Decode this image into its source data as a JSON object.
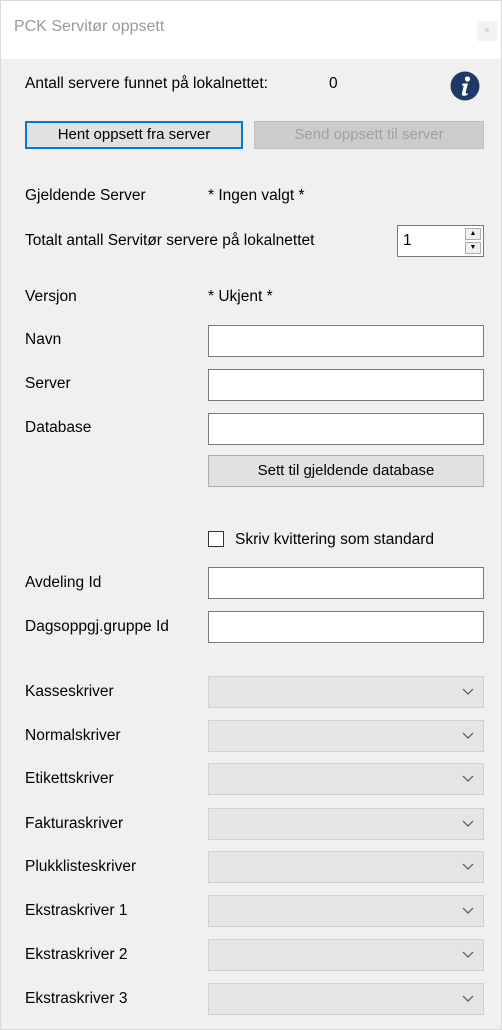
{
  "window": {
    "title": "PCK Servitør oppsett",
    "close_glyph": "×"
  },
  "header": {
    "servers_found_label": "Antall servere funnet på lokalnettet:",
    "servers_found_count": "0",
    "info_icon": "info-icon"
  },
  "buttons": {
    "fetch_label": "Hent oppsett fra server",
    "send_label": "Send oppsett til server",
    "set_db_label": "Sett til gjeldende database"
  },
  "current_server": {
    "label": "Gjeldende Server",
    "value": "* Ingen valgt *"
  },
  "total_servers": {
    "label": "Totalt antall Servitør servere på lokalnettet",
    "value": "1"
  },
  "version": {
    "label": "Versjon",
    "value": "* Ukjent *"
  },
  "fields": {
    "name_label": "Navn",
    "server_label": "Server",
    "database_label": "Database",
    "department_label": "Avdeling Id",
    "daily_group_label": "Dagsoppgj.gruppe Id"
  },
  "receipt_checkbox": {
    "label": "Skriv kvittering som standard",
    "checked": false
  },
  "printers": [
    {
      "label": "Kasseskriver"
    },
    {
      "label": "Normalskriver"
    },
    {
      "label": "Etikettskriver"
    },
    {
      "label": "Fakturaskriver"
    },
    {
      "label": "Plukklisteskriver"
    },
    {
      "label": "Ekstraskriver 1"
    },
    {
      "label": "Ekstraskriver 2"
    },
    {
      "label": "Ekstraskriver 3"
    }
  ]
}
